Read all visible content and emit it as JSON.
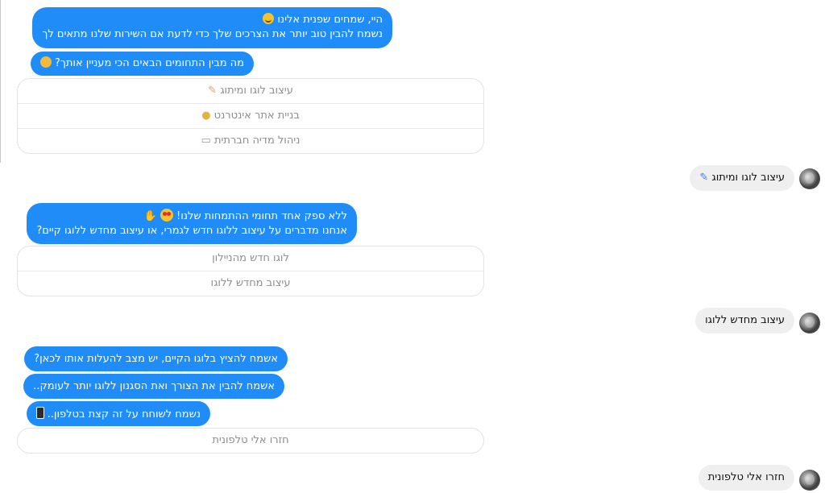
{
  "messages": {
    "m1_line1": "היי, שמחים שפנית אלינו 😊",
    "m1_line1_text": "היי, שמחים שפנית אלינו",
    "m1_line2": "נשמח להבין טוב יותר את הצרכים שלך כדי לדעת אם השירות שלנו מתאים לך",
    "m2_text": "מה מבין התחומים הבאים הכי מעניין אותך?",
    "m3_line1_text": "ללא ספק אחד תחומי ההתמחות שלנו!",
    "m3_line2": "אנחנו מדברים על עיצוב ללוגו חדש לגמרי, או עיצוב מחדש ללוגו קיים?",
    "m4_text": "אשמח להציץ בלוגו הקיים, יש מצב להעלות אותו לכאן?",
    "m5_text": "אשמח להבין את הצורך ואת הסגנון ללוגו יותר לעומק..",
    "m6_text": "נשמח לשוחח על זה קצת בטלפון..",
    "m6_icon": "phone-icon"
  },
  "quick_replies_1": [
    {
      "label": "עיצוב לוגו ומיתוג",
      "icon": "✎"
    },
    {
      "label": "בניית אתר אינטרנט",
      "icon": "💡"
    },
    {
      "label": "ניהול מדיה חברתית",
      "icon": "💬"
    }
  ],
  "quick_replies_2": [
    {
      "label": "לוגו חדש מהניילון"
    },
    {
      "label": "עיצוב מחדש ללוגו"
    }
  ],
  "quick_replies_3": [
    {
      "label": "חזרו אלי טלפונית"
    }
  ],
  "user_replies": {
    "r1_text": "עיצוב לוגו ומיתוג",
    "r1_icon": "✎",
    "r2_text": "עיצוב מחדש ללוגו",
    "r3_text": "חזרו אלי טלפונית"
  },
  "colors": {
    "bot_bubble": "#1f8cf8",
    "user_bubble": "#efefef",
    "quick_reply_text": "#8e8e8e"
  }
}
